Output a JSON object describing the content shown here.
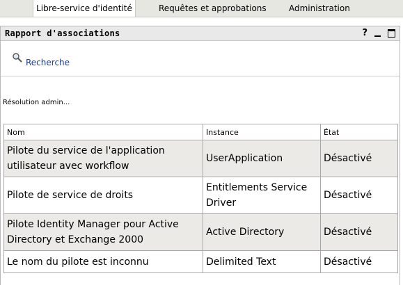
{
  "tabs": [
    {
      "label": "Libre-service d'identité",
      "active": true
    },
    {
      "label": "Requêtes et approbations",
      "active": false
    },
    {
      "label": "Administration",
      "active": false
    }
  ],
  "portlet": {
    "title": "Rapport d'associations",
    "help_label": "?",
    "search_link": "Recherche",
    "status_text": "Résolution admin..."
  },
  "table": {
    "headers": [
      "Nom",
      "Instance",
      "État"
    ],
    "rows": [
      {
        "name": "Pilote du service de l'application utilisateur avec workflow",
        "instance": "UserApplication",
        "state": "Désactivé"
      },
      {
        "name": "Pilote de service de droits",
        "instance": "Entitlements Service Driver",
        "state": "Désactivé"
      },
      {
        "name": "Pilote Identity Manager pour Active Directory et Exchange 2000",
        "instance": "Active Directory",
        "state": "Désactivé"
      },
      {
        "name": "Le nom du pilote est inconnu",
        "instance": "Delimited Text",
        "state": "Désactivé"
      }
    ]
  },
  "colors": {
    "tabbar_bg": "#e7e7e2",
    "link": "#1b3c8c",
    "row_shade": "#ebeae6"
  }
}
